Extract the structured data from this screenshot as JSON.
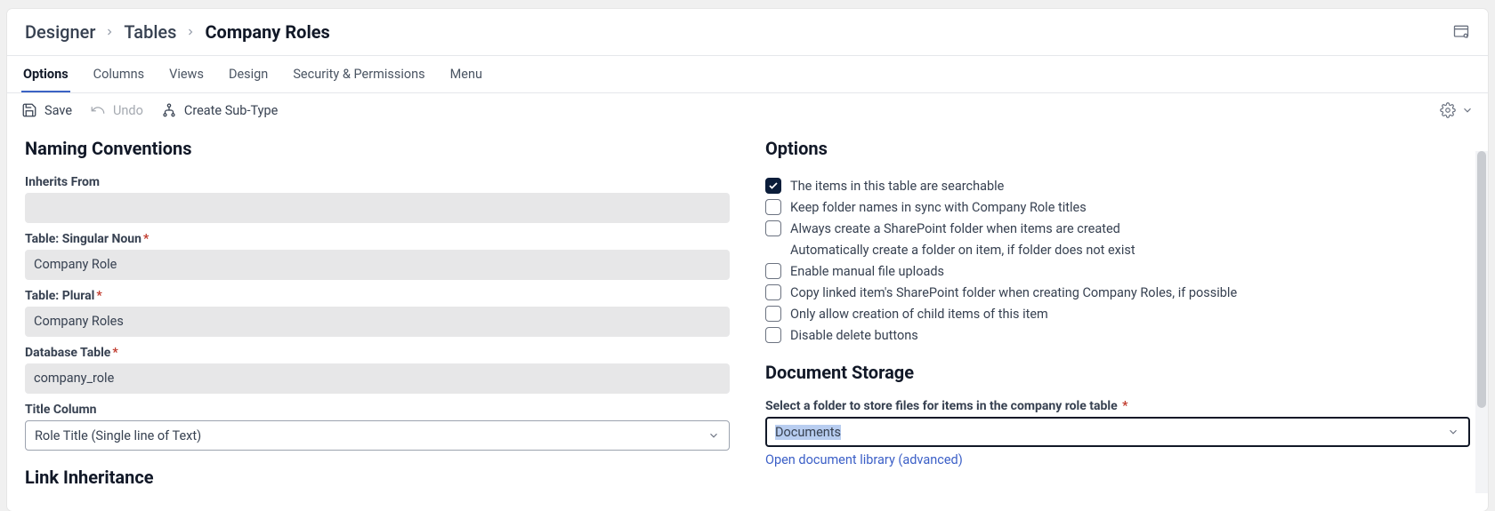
{
  "breadcrumb": {
    "items": [
      "Designer",
      "Tables",
      "Company Roles"
    ]
  },
  "tabs": [
    {
      "label": "Options",
      "active": true
    },
    {
      "label": "Columns",
      "active": false
    },
    {
      "label": "Views",
      "active": false
    },
    {
      "label": "Design",
      "active": false
    },
    {
      "label": "Security & Permissions",
      "active": false
    },
    {
      "label": "Menu",
      "active": false
    }
  ],
  "toolbar": {
    "save": "Save",
    "undo": "Undo",
    "create_subtype": "Create Sub-Type"
  },
  "naming": {
    "section_title": "Naming Conventions",
    "inherits_from_label": "Inherits From",
    "inherits_from_value": "",
    "singular_label": "Table: Singular Noun",
    "singular_value": "Company Role",
    "plural_label": "Table: Plural",
    "plural_value": "Company Roles",
    "db_label": "Database Table",
    "db_value": "company_role",
    "title_col_label": "Title Column",
    "title_col_value": "Role Title (Single line of Text)"
  },
  "link_inheritance_title": "Link Inheritance",
  "options": {
    "section_title": "Options",
    "items": [
      {
        "label": "The items in this table are searchable",
        "checked": true,
        "box": true
      },
      {
        "label": "Keep folder names in sync with Company Role titles",
        "checked": false,
        "box": true
      },
      {
        "label": "Always create a SharePoint folder when items are created",
        "checked": false,
        "box": true
      },
      {
        "label": "Automatically create a folder on item, if folder does not exist",
        "checked": false,
        "box": false
      },
      {
        "label": "Enable manual file uploads",
        "checked": false,
        "box": true
      },
      {
        "label": "Copy linked item's SharePoint folder when creating Company Roles, if possible",
        "checked": false,
        "box": true
      },
      {
        "label": "Only allow creation of child items of this item",
        "checked": false,
        "box": true
      },
      {
        "label": "Disable delete buttons",
        "checked": false,
        "box": true
      }
    ]
  },
  "doc_storage": {
    "section_title": "Document Storage",
    "folder_label": "Select a folder to store files for items in the company role table",
    "folder_value": "Documents",
    "open_link": "Open document library (advanced)"
  }
}
